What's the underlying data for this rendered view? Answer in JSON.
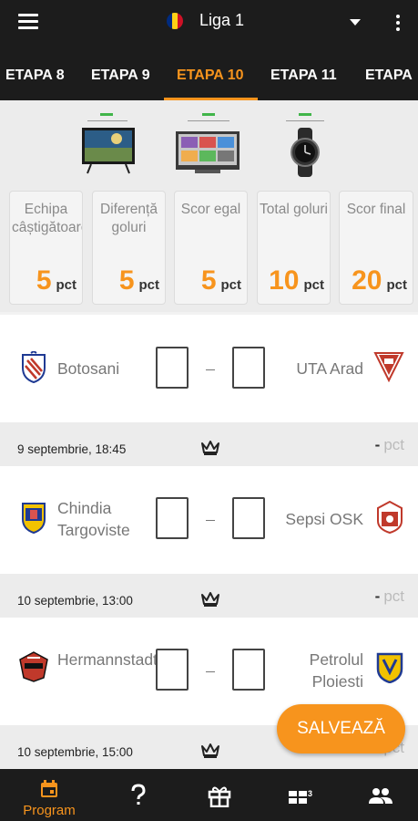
{
  "header": {
    "league": "Liga 1"
  },
  "tabs": [
    {
      "label": "ETAPA 8",
      "active": false
    },
    {
      "label": "ETAPA 9",
      "active": false
    },
    {
      "label": "ETAPA 10",
      "active": true
    },
    {
      "label": "ETAPA 11",
      "active": false
    },
    {
      "label": "ETAPA",
      "active": false
    }
  ],
  "scoring": [
    {
      "label": "Echipa câștigătoare",
      "points": "5",
      "unit": "pct"
    },
    {
      "label": "Diferență goluri",
      "points": "5",
      "unit": "pct"
    },
    {
      "label": "Scor egal",
      "points": "5",
      "unit": "pct"
    },
    {
      "label": "Total goluri",
      "points": "10",
      "unit": "pct"
    },
    {
      "label": "Scor final",
      "points": "20",
      "unit": "pct"
    }
  ],
  "matches": [
    {
      "home": "Botosani",
      "away": "UTA Arad",
      "date": "9 septembrie, 18:45",
      "score_dash": "–",
      "points": "-",
      "points_unit": "pct"
    },
    {
      "home": "Chindia Targoviste",
      "away": "Sepsi OSK",
      "date": "10 septembrie, 13:00",
      "score_dash": "–",
      "points": "-",
      "points_unit": "pct"
    },
    {
      "home": "Hermannstadt",
      "away": "Petrolul Ploiesti",
      "date": "10 septembrie, 15:00",
      "score_dash": "–",
      "points": "-",
      "points_unit": "pct"
    }
  ],
  "save_button": "SALVEAZĂ",
  "bottom_nav": [
    {
      "icon": "calendar-icon",
      "label": "Program",
      "active": true
    },
    {
      "icon": "help-icon",
      "label": "",
      "active": false
    },
    {
      "icon": "gift-icon",
      "label": "",
      "active": false
    },
    {
      "icon": "ticket-icon",
      "label": "",
      "active": false
    },
    {
      "icon": "people-icon",
      "label": "",
      "active": false
    }
  ],
  "colors": {
    "accent": "#f7941d",
    "dark": "#1c1c1c",
    "flag": [
      "#002b7f",
      "#fcd116",
      "#ce1126"
    ]
  }
}
